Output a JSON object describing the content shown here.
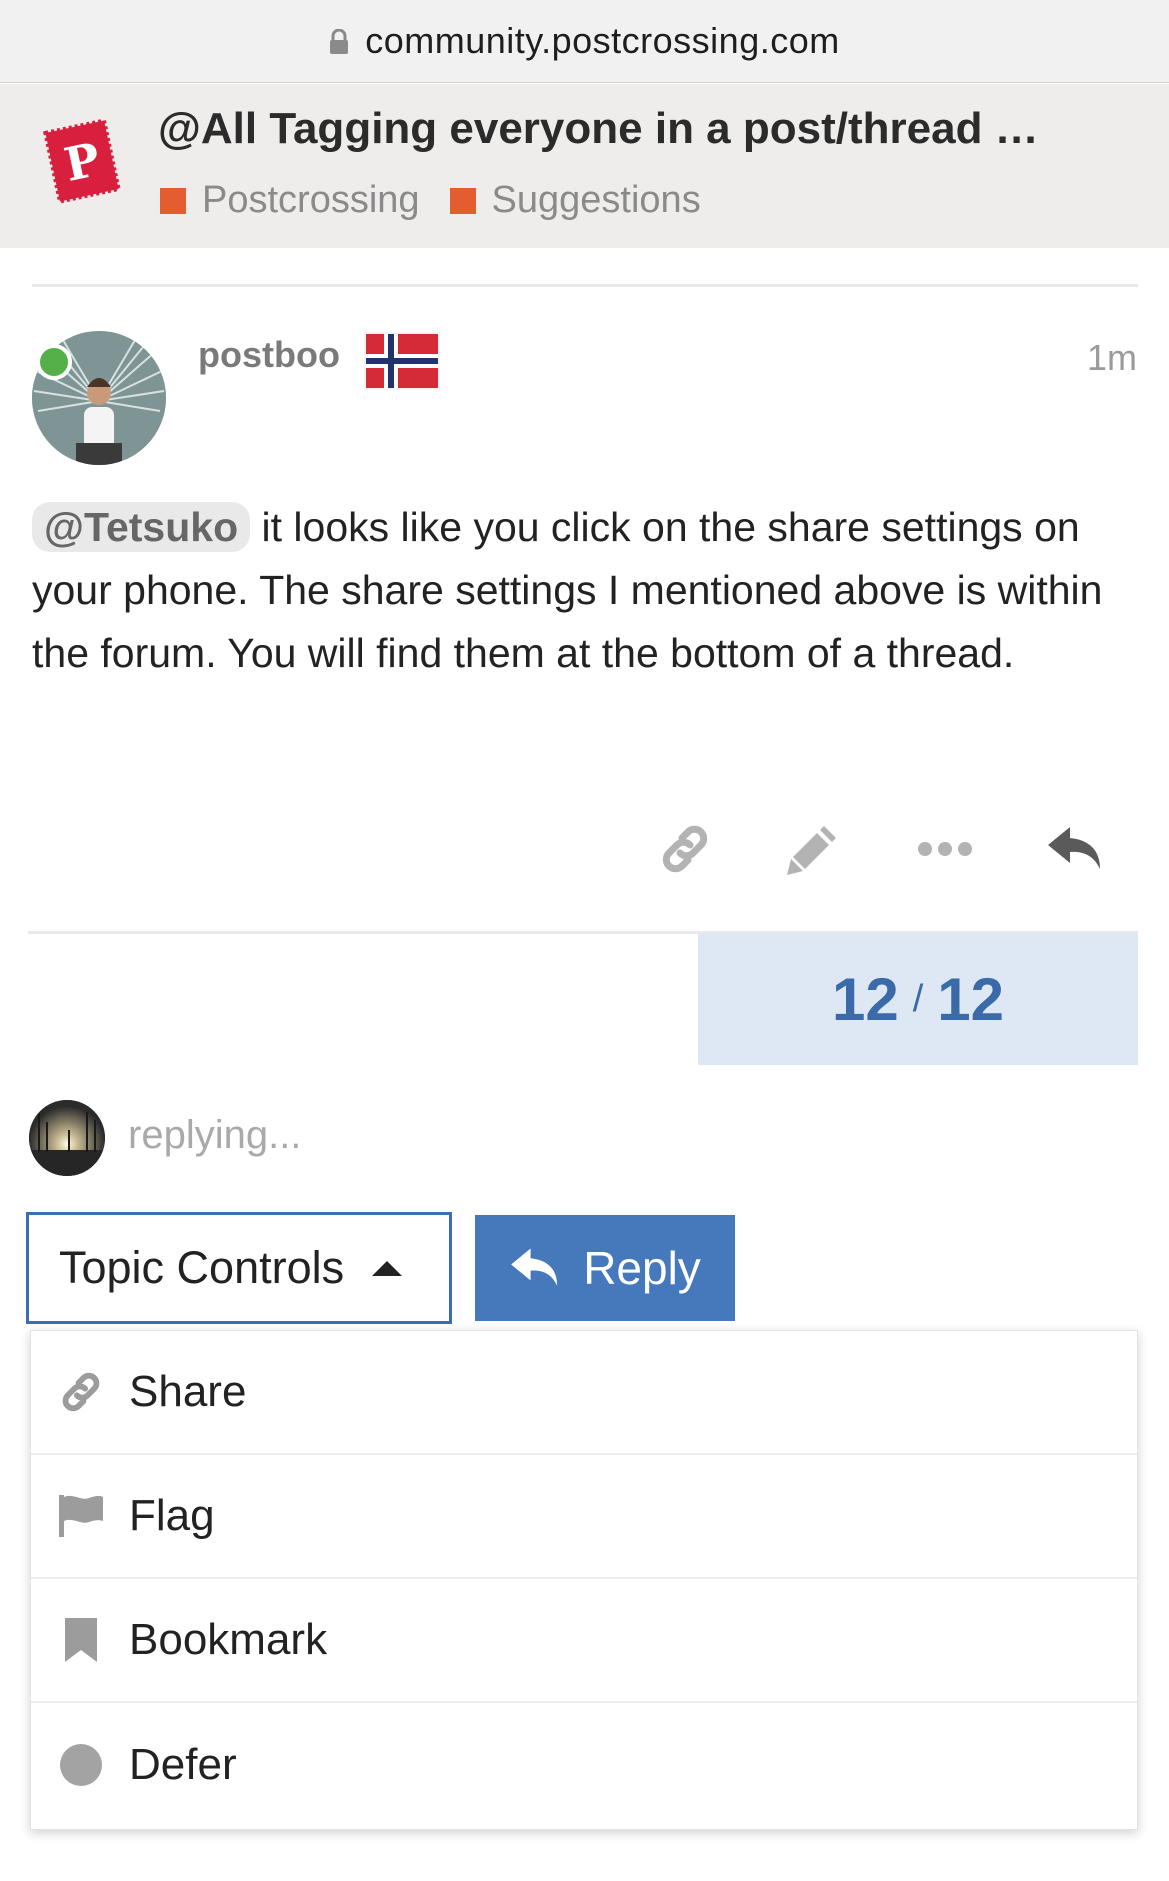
{
  "browser": {
    "url": "community.postcrossing.com"
  },
  "topic": {
    "title": "@All Tagging everyone in a post/thread …",
    "categories": [
      {
        "label": "Postcrossing",
        "color": "#e45d31"
      },
      {
        "label": "Suggestions",
        "color": "#e45d31"
      }
    ]
  },
  "post": {
    "username": "postboo",
    "time": "1m",
    "mention": "@Tetsuko",
    "text": " it looks like you click on the share settings on your phone. The share settings I mentioned above is within the forum. You will find them at the bottom of a thread.",
    "actions": [
      "link-icon",
      "pencil-icon",
      "more-icon",
      "reply-arrow-icon"
    ]
  },
  "progress": {
    "current": "12",
    "separator": "/",
    "total": "12"
  },
  "replying": {
    "label": "replying..."
  },
  "controls": {
    "topic_controls_label": "Topic Controls",
    "reply_label": "Reply"
  },
  "menu": {
    "items": [
      {
        "label": "Share",
        "icon": "link-icon"
      },
      {
        "label": "Flag",
        "icon": "flag-icon"
      },
      {
        "label": "Bookmark",
        "icon": "bookmark-icon"
      },
      {
        "label": "Defer",
        "icon": "circle-icon"
      }
    ]
  },
  "colors": {
    "accent": "#4679bc",
    "progress_bg": "#dde8f4",
    "online": "#56b04a",
    "logo_red": "#d8203e"
  }
}
